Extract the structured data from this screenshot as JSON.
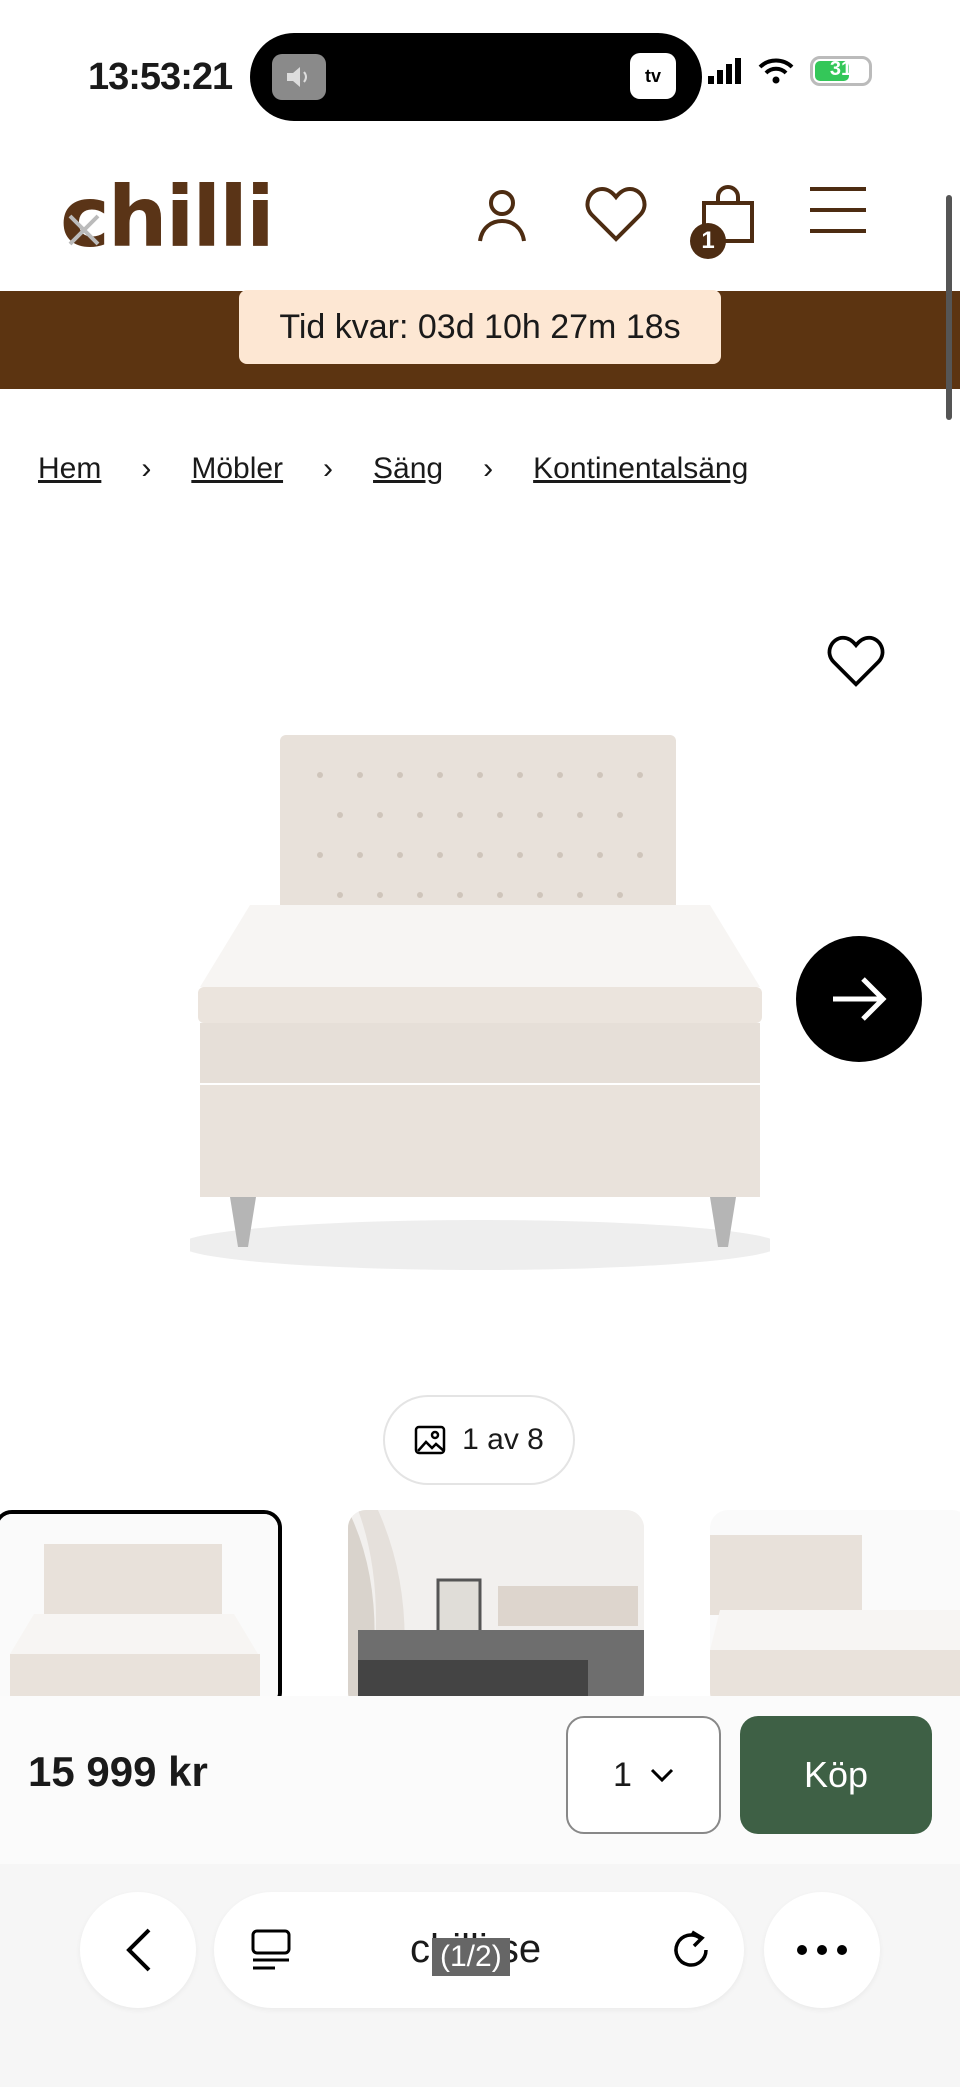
{
  "status_bar": {
    "time": "13:53:21"
  },
  "header": {
    "logo": "chilli",
    "cart_count": "1"
  },
  "timer": {
    "text": "Tid kvar: 03d 10h 27m 18s"
  },
  "breadcrumb": {
    "items": [
      "Hem",
      "Möbler",
      "Säng",
      "Kontinentalsäng"
    ]
  },
  "gallery": {
    "counter": "1 av 8"
  },
  "buy": {
    "price": "15 999 kr",
    "quantity": "1",
    "button": "Köp"
  },
  "browser": {
    "url": "chilli.se",
    "page_indicator": "(1/2)"
  }
}
